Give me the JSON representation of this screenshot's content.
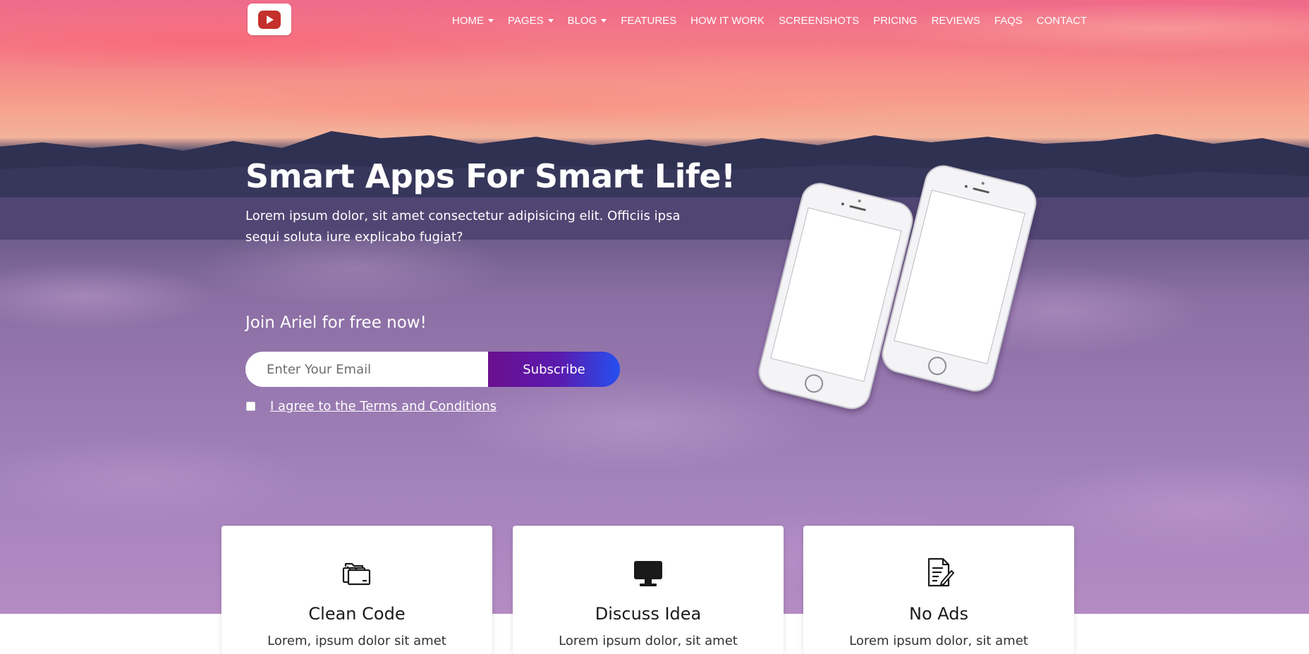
{
  "nav": {
    "logo_icon": "play-button-icon",
    "items": [
      {
        "label": "HOME",
        "dropdown": true
      },
      {
        "label": "PAGES",
        "dropdown": true
      },
      {
        "label": "BLOG",
        "dropdown": true
      },
      {
        "label": "FEATURES",
        "dropdown": false
      },
      {
        "label": "HOW IT WORK",
        "dropdown": false
      },
      {
        "label": "SCREENSHOTS",
        "dropdown": false
      },
      {
        "label": "PRICING",
        "dropdown": false
      },
      {
        "label": "REVIEWS",
        "dropdown": false
      },
      {
        "label": "FAQS",
        "dropdown": false
      },
      {
        "label": "CONTACT",
        "dropdown": false
      }
    ]
  },
  "hero": {
    "title": "Smart Apps For Smart Life!",
    "subtitle": "Lorem ipsum dolor, sit amet consectetur adipisicing elit. Officiis ipsa sequi soluta iure explicabo fugiat?",
    "join_text": "Join Ariel for free now!",
    "email_placeholder": "Enter Your Email",
    "email_value": "",
    "subscribe_label": "Subscribe",
    "terms_checked": false,
    "terms_label": "I agree to the Terms and Conditions"
  },
  "features": [
    {
      "icon": "folders-icon",
      "title": "Clean Code",
      "text": "Lorem, ipsum dolor sit amet"
    },
    {
      "icon": "monitor-icon",
      "title": "Discuss Idea",
      "text": "Lorem ipsum dolor, sit amet"
    },
    {
      "icon": "document-edit-icon",
      "title": "No Ads",
      "text": "Lorem ipsum dolor, sit amet"
    }
  ],
  "colors": {
    "subscribe_gradient_start": "#6a0f8e",
    "subscribe_gradient_end": "#2450f0",
    "logo_icon": "#c4302b"
  }
}
